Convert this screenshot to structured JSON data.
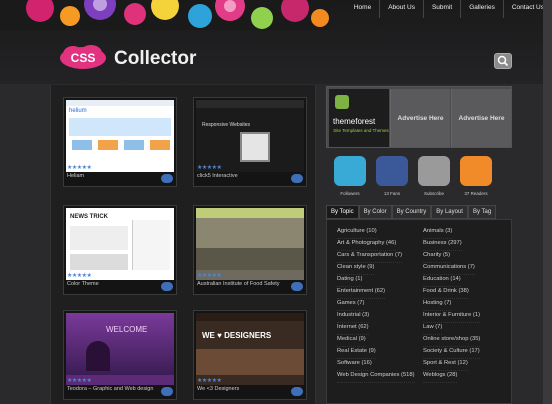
{
  "nav": [
    "Home",
    "About Us",
    "Submit",
    "Galleries",
    "Contact Us"
  ],
  "logo": {
    "badge": "CSS",
    "title": "Collector"
  },
  "gallery": [
    {
      "title": "Heliam"
    },
    {
      "title": "click5 Interactive"
    },
    {
      "title": "Color Theme"
    },
    {
      "title": "Australian Institute of Food Safety"
    },
    {
      "title": "Teodora – Graphic and Web design"
    },
    {
      "title": "We <3 Designers"
    }
  ],
  "thumb_text": {
    "heliam": "helium",
    "click5": "Responsive Websites",
    "newstrick": "NEWS TRICK",
    "designers": "WE ♥ DESIGNERS",
    "welcome": "WELCOME"
  },
  "stars": "★★★★★",
  "ads": {
    "themeforest": "themeforest",
    "themeforest_sub": "Site Templates and Themes",
    "slot1": "Advertise Here",
    "slot2": "Advertise Here"
  },
  "social": [
    {
      "icon": "twitter-icon",
      "label": "Followers",
      "color": "#39a9d6"
    },
    {
      "icon": "facebook-icon",
      "label": "13 Fans",
      "color": "#3b5998"
    },
    {
      "icon": "email-icon",
      "label": "Subscribe",
      "color": "#9a9a9a"
    },
    {
      "icon": "rss-icon",
      "label": "37 Readers",
      "color": "#f18b2a"
    }
  ],
  "tabs": [
    "By Topic",
    "By Color",
    "By Country",
    "By Layout",
    "By Tag"
  ],
  "topics_left": [
    "Agriculture (10)",
    "Art & Photography (46)",
    "Cars & Transportation (7)",
    "Clean style (9)",
    "Dating (1)",
    "Entertainment (62)",
    "Games (7)",
    "Industrial (3)",
    "Internet (62)",
    "Medical (9)",
    "Real Estate (9)",
    "Software (16)",
    "Web Design Companies (518)"
  ],
  "topics_right": [
    "Animals (3)",
    "Business (297)",
    "Charity (5)",
    "Communications (7)",
    "Education (14)",
    "Food & Drink (38)",
    "Hosting (7)",
    "Interior & Furniture (1)",
    "Law (7)",
    "Online store/shop (35)",
    "Society & Culture (17)",
    "Sport & Rest (12)",
    "Weblogs (28)"
  ]
}
